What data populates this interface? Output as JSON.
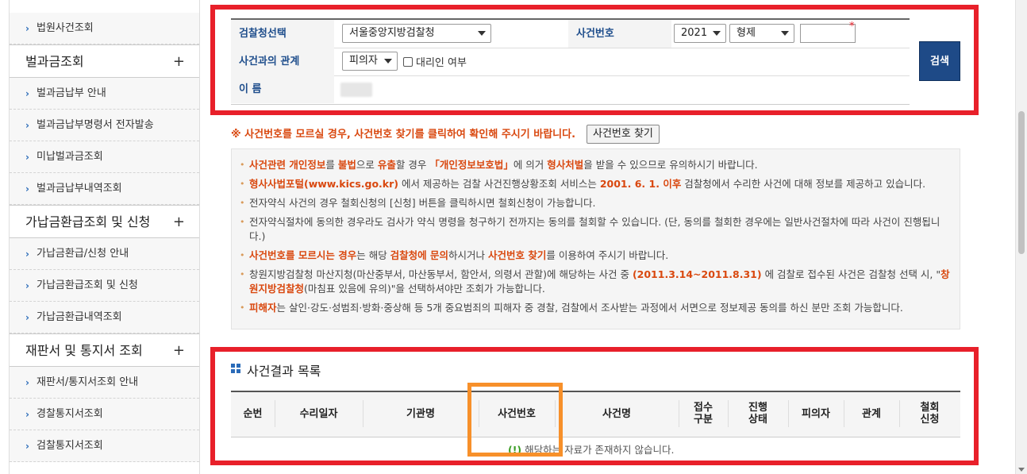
{
  "sidebar": {
    "items": [
      {
        "type": "sub",
        "label": "법원사건조회"
      },
      {
        "type": "head",
        "label": "벌과금조회",
        "toggle": "+"
      },
      {
        "type": "sub",
        "label": "벌과금납부 안내"
      },
      {
        "type": "sub",
        "label": "벌과금납부명령서 전자발송"
      },
      {
        "type": "sub",
        "label": "미납벌과금조회"
      },
      {
        "type": "sub",
        "label": "벌과금납부내역조회"
      },
      {
        "type": "head",
        "label": "가납금환급조회 및 신청",
        "toggle": "+"
      },
      {
        "type": "sub",
        "label": "가납금환급/신청 안내"
      },
      {
        "type": "sub",
        "label": "가납금환급조회 및 신청"
      },
      {
        "type": "sub",
        "label": "가납금환급내역조회"
      },
      {
        "type": "head",
        "label": "재판서 및 통지서 조회",
        "toggle": "+"
      },
      {
        "type": "sub",
        "label": "재판서/통지서조회 안내"
      },
      {
        "type": "sub",
        "label": "경찰통지서조회"
      },
      {
        "type": "sub",
        "label": "검찰통지서조회"
      }
    ]
  },
  "search": {
    "office_label": "검찰청선택",
    "office_value": "서울중앙지방검찰청",
    "case_no_label": "사건번호",
    "year_value": "2021",
    "type_value": "형제",
    "case_no_value": "",
    "relation_label": "사건과의 관계",
    "relation_value": "피의자",
    "proxy_label": "대리인 여부",
    "name_label": "이 름",
    "search_button": "검색"
  },
  "notice": {
    "line": "※ 사건번호를 모르실 경우, 사건번호 찾기를 클릭하여 확인해 주시기 바랍니다.",
    "find_button": "사건번호 찾기"
  },
  "info": [
    [
      {
        "t": "사건관련 개인정보",
        "h": true
      },
      {
        "t": "를 "
      },
      {
        "t": "불법",
        "h": true
      },
      {
        "t": "으로 "
      },
      {
        "t": "유출",
        "h": true
      },
      {
        "t": "할 경우 "
      },
      {
        "t": "「개인정보보호법」",
        "h": true
      },
      {
        "t": "에 의거 "
      },
      {
        "t": "형사처벌",
        "h": true
      },
      {
        "t": "을 받을 수 있으므로 유의하시기 바랍니다."
      }
    ],
    [
      {
        "t": "형사사법포털(www.kics.go.kr)",
        "h": true
      },
      {
        "t": " 에서 제공하는 검찰 사건진행상황조회 서비스는 "
      },
      {
        "t": "2001. 6. 1. 이후",
        "h": true
      },
      {
        "t": " 검찰청에서 수리한 사건에 대해 정보를 제공하고 있습니다."
      }
    ],
    [
      {
        "t": "전자약식 사건의 경우 철회신청의 [신청] 버튼을 클릭하시면 철회신청이 가능합니다."
      }
    ],
    [
      {
        "t": "전자약식절차에 동의한 경우라도 검사가 약식 명령을 청구하기 전까지는 동의를 철회할 수 있습니다. (단, 동의를 철회한 경우에는 일반사건절차에 따라 사건이 진행됩니다.)"
      }
    ],
    [
      {
        "t": "사건번호를 모르시는 경우",
        "h": true
      },
      {
        "t": "는 해당 "
      },
      {
        "t": "검찰청에 문의",
        "h": true
      },
      {
        "t": "하시거나 "
      },
      {
        "t": "사건번호 찾기",
        "h": true
      },
      {
        "t": "를 이용하여 주시기 바랍니다."
      }
    ],
    [
      {
        "t": "창원지방검찰청 마산지청(마산중부서, 마산동부서, 함안서, 의령서 관할)에 해당하는 사건 중 "
      },
      {
        "t": "(2011.3.14~2011.8.31)",
        "h": true
      },
      {
        "t": " 에 검찰로 접수된 사건은 검찰청 선택 시, \""
      },
      {
        "t": "창원지방검찰청",
        "h": true
      },
      {
        "t": "(마침표 있음에 유의)\"을 선택하셔야만 조회가 가능합니다."
      }
    ],
    [
      {
        "t": "피해자",
        "h": true
      },
      {
        "t": "는 살인·강도·성범죄·방화·중상해 등 5개 중요범죄의 피해자 중 경찰, 검찰에서 조사받는 과정에서 서면으로 정보제공 동의를 하신 분만 조회 가능합니다."
      }
    ]
  ],
  "results": {
    "title": "사건결과 목록",
    "columns": [
      "순번",
      "수리일자",
      "기관명",
      "사건번호",
      "사건명",
      "접수\n구분",
      "진행\n상태",
      "피의자",
      "관계",
      "철회\n신청"
    ],
    "empty_mark": "(!)",
    "empty_text": " 해당하는 자료가 존재하지 않습니다."
  },
  "colors": {
    "highlight_red": "#e8202a",
    "highlight_orange": "#f7902a",
    "accent_blue": "#1e4a87",
    "emphasis": "#d9480f"
  }
}
